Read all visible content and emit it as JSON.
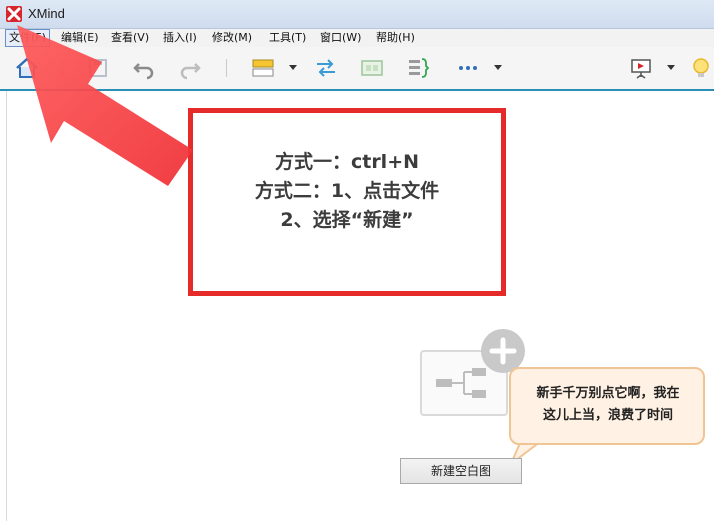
{
  "window": {
    "title": "XMind"
  },
  "menu": [
    {
      "label": "文件(F)"
    },
    {
      "label": "编辑(E)"
    },
    {
      "label": "查看(V)"
    },
    {
      "label": "插入(I)"
    },
    {
      "label": "修改(M)"
    },
    {
      "label": "工具(T)"
    },
    {
      "label": "窗口(W)"
    },
    {
      "label": "帮助(H)"
    }
  ],
  "toolbar": {
    "icons": [
      "home-icon",
      "save-icon",
      "undo-icon",
      "redo-icon",
      "topic-style-icon",
      "relationship-icon",
      "summary-icon",
      "boundary-icon",
      "more-icon",
      "presentation-icon",
      "idea-lightbulb-icon"
    ]
  },
  "annotation": {
    "line1": "方式一：ctrl+N",
    "line2": "方式二：1、点击文件",
    "line3": "2、选择“新建”"
  },
  "tip": {
    "line1": "新手千万别点它啊，我在",
    "line2": "这儿上当，浪费了时间"
  },
  "new_blank_label": "新建空白图",
  "colors": {
    "accent_rule": "#2a8fb7",
    "annotation_red": "#e52a2a",
    "tip_bg": "#fff1e3",
    "tip_border": "#f0c596"
  }
}
